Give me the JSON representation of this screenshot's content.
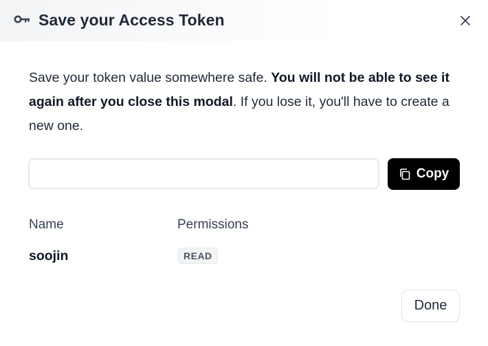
{
  "modal": {
    "title": "Save your Access Token",
    "message": {
      "part1": "Save your token value somewhere safe. ",
      "bold": "You will not be able to see it again after you close this modal",
      "part2": ". If you lose it, you'll have to create a new one."
    }
  },
  "token_field": {
    "value": "",
    "placeholder": ""
  },
  "copy_button": {
    "label": "Copy",
    "icon": "copy-icon"
  },
  "token_table": {
    "headers": {
      "name": "Name",
      "permissions": "Permissions"
    },
    "row": {
      "name": "soojin",
      "permission": "READ"
    }
  },
  "done_button": {
    "label": "Done"
  },
  "icons": {
    "header": "key-icon",
    "close": "close-icon"
  },
  "colors": {
    "primary_button_bg": "#000000",
    "badge_bg": "#f3f4f6"
  }
}
